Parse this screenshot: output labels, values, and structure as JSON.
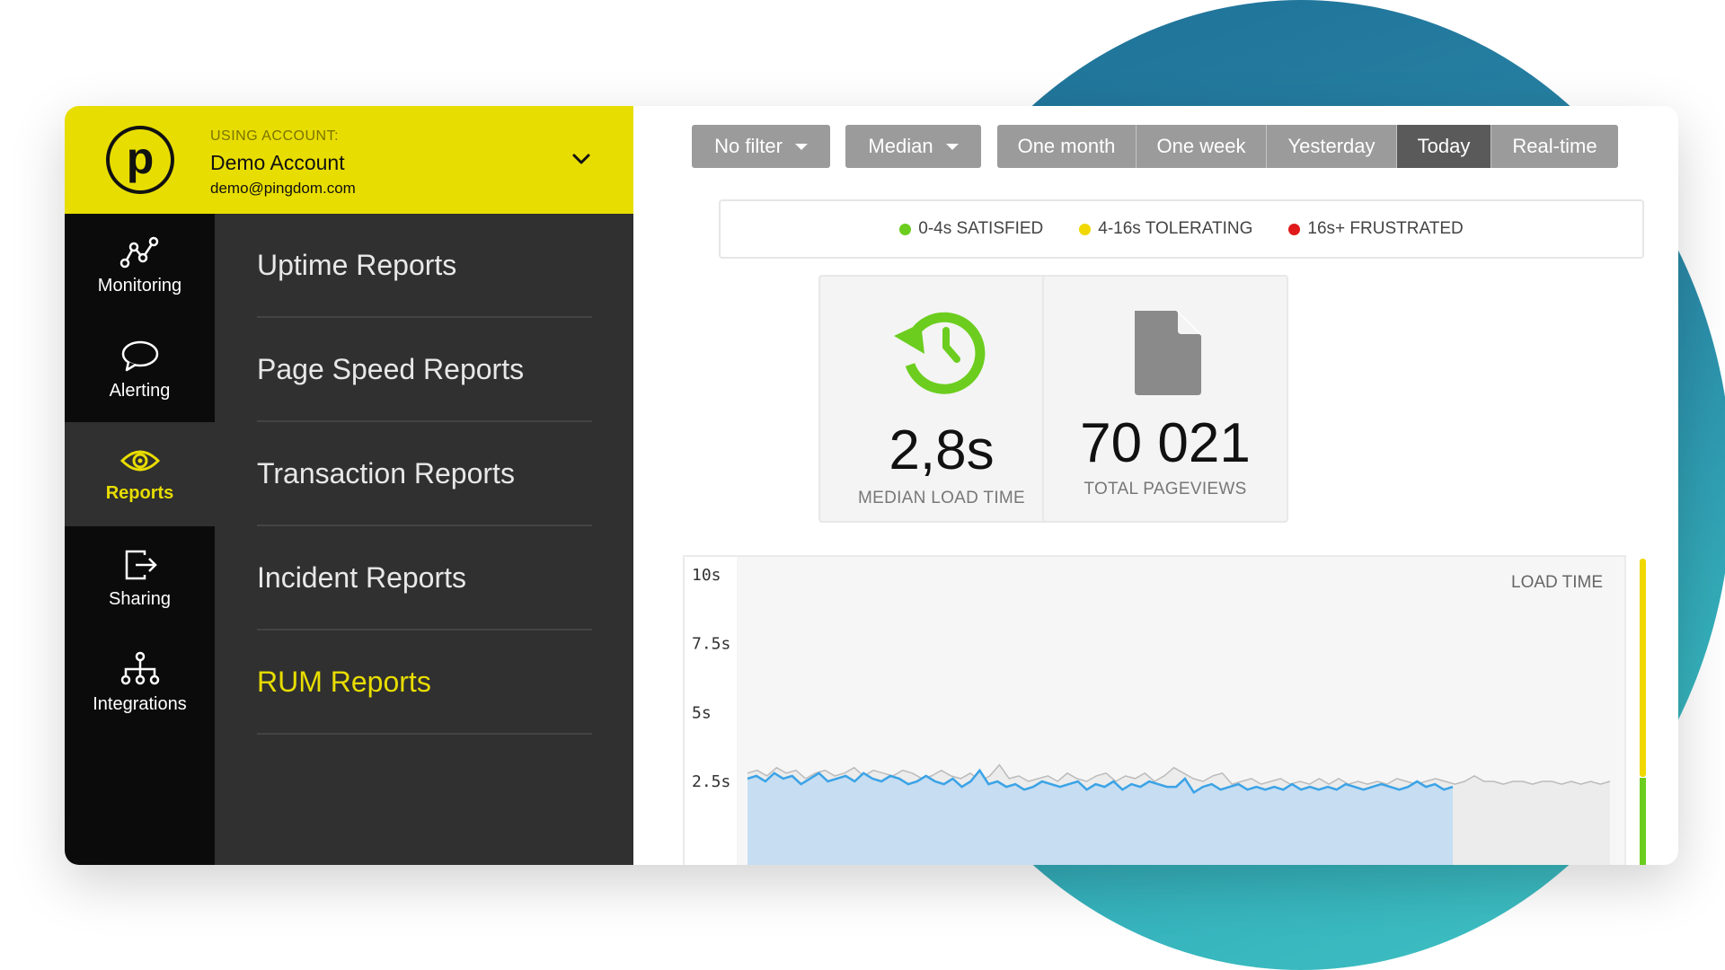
{
  "account": {
    "label": "USING ACCOUNT:",
    "name": "Demo Account",
    "email": "demo@pingdom.com",
    "logo_letter": "p"
  },
  "nav": {
    "items": [
      {
        "label": "Monitoring",
        "icon": "monitoring-icon"
      },
      {
        "label": "Alerting",
        "icon": "speech-bubble-icon"
      },
      {
        "label": "Reports",
        "icon": "eye-icon",
        "active": true
      },
      {
        "label": "Sharing",
        "icon": "share-icon"
      },
      {
        "label": "Integrations",
        "icon": "hierarchy-icon"
      }
    ]
  },
  "reports_menu": {
    "items": [
      {
        "label": "Uptime Reports"
      },
      {
        "label": "Page Speed Reports"
      },
      {
        "label": "Transaction Reports"
      },
      {
        "label": "Incident Reports"
      },
      {
        "label": "RUM Reports",
        "active": true
      }
    ]
  },
  "toolbar": {
    "filter": "No filter",
    "aggregate": "Median",
    "ranges": [
      "One month",
      "One week",
      "Yesterday",
      "Today",
      "Real-time"
    ],
    "active_range": "Today"
  },
  "legend": [
    {
      "label": "0-4s SATISFIED",
      "color": "#6ccd1e"
    },
    {
      "label": "4-16s TOLERATING",
      "color": "#f0d800"
    },
    {
      "label": "16s+ FRUSTRATED",
      "color": "#e01a1a"
    }
  ],
  "stats": {
    "median": {
      "value": "2,8s",
      "label": "MEDIAN LOAD TIME",
      "icon": "clock-history-icon"
    },
    "pageviews": {
      "value": "70 021",
      "label": "TOTAL PAGEVIEWS",
      "icon": "document-icon"
    }
  },
  "chart_data": {
    "type": "area",
    "title": "LOAD TIME",
    "yticks": [
      "10s",
      "7.5s",
      "5s",
      "2.5s"
    ],
    "ylim": [
      0,
      10
    ],
    "series": [
      {
        "color": "#3ba3e6",
        "values": [
          2.6,
          2.7,
          2.5,
          2.8,
          2.6,
          2.7,
          2.4,
          2.6,
          2.8,
          2.5,
          2.6,
          2.7,
          2.5,
          2.8,
          2.6,
          2.5,
          2.7,
          2.6,
          2.4,
          2.5,
          2.7,
          2.5,
          2.4,
          2.6,
          2.3,
          2.5,
          2.9,
          2.4,
          2.5,
          2.3,
          2.4,
          2.2,
          2.3,
          2.5,
          2.4,
          2.3,
          2.4,
          2.5,
          2.2,
          2.4,
          2.3,
          2.5,
          2.2,
          2.4,
          2.3,
          2.5,
          2.4,
          2.3,
          2.3,
          2.6,
          2.1,
          2.3,
          2.4,
          2.2,
          2.3,
          2.4,
          2.2,
          2.3,
          2.2,
          2.3,
          2.2,
          2.4,
          2.2,
          2.3,
          2.2,
          2.3,
          2.2,
          2.4,
          2.3,
          2.2,
          2.3,
          2.4,
          2.3,
          2.2,
          2.3,
          2.5,
          2.3,
          2.4,
          2.2,
          2.3
        ]
      },
      {
        "color": "#bbbbbb",
        "values": [
          2.8,
          2.9,
          2.7,
          3.0,
          2.8,
          2.9,
          2.6,
          2.8,
          2.9,
          2.7,
          2.8,
          3.0,
          2.7,
          2.9,
          2.8,
          2.7,
          2.9,
          2.8,
          2.6,
          2.7,
          2.9,
          2.7,
          2.6,
          2.8,
          2.5,
          2.7,
          3.1,
          2.6,
          2.7,
          2.5,
          2.6,
          2.7,
          2.5,
          2.8,
          2.6,
          2.5,
          2.7,
          2.8,
          2.5,
          2.7,
          2.6,
          2.8,
          2.5,
          2.7,
          3.0,
          2.8,
          2.6,
          2.5,
          2.7,
          2.8,
          2.4,
          2.5,
          2.6,
          2.4,
          2.5,
          2.6,
          2.4,
          2.5,
          2.4,
          2.6,
          2.4,
          2.6,
          2.4,
          2.5,
          2.4,
          2.5,
          2.4,
          2.6,
          2.5,
          2.4,
          2.5,
          2.6,
          2.5,
          2.4,
          2.5,
          2.7,
          2.5,
          2.5,
          2.4,
          2.5,
          2.5,
          2.4,
          2.5,
          2.5,
          2.4,
          2.5,
          2.4,
          2.5,
          2.4,
          2.5
        ]
      }
    ]
  }
}
